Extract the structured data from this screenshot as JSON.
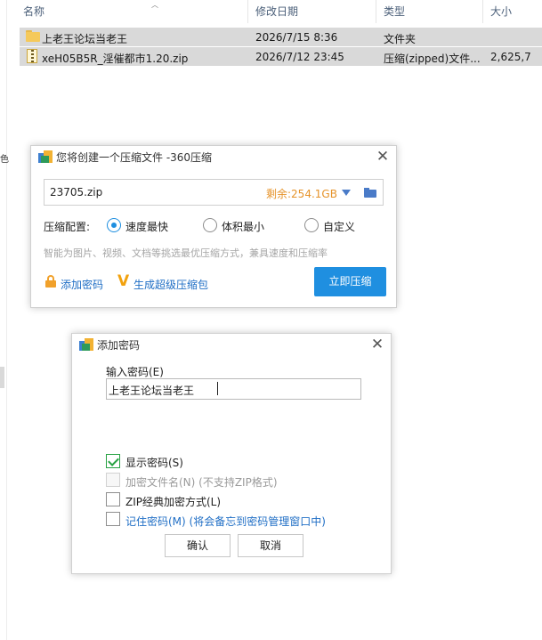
{
  "explorer": {
    "columns": {
      "name": "名称",
      "modified": "修改日期",
      "type": "类型",
      "size": "大小"
    },
    "files": [
      {
        "icon": "folder-icon",
        "name": "上老王论坛当老王",
        "modified": "2026/7/15 8:36",
        "type": "文件夹",
        "size": ""
      },
      {
        "icon": "zip-file-icon",
        "name": "xeH05B5R_淫催都市1.20.zip",
        "modified": "2026/7/12 23:45",
        "type": "压缩(zipped)文件...",
        "size": "2,625,7"
      }
    ],
    "left_glyph": "色"
  },
  "compress_dialog": {
    "title": "您将创建一个压缩文件 -360压缩",
    "archive_name": "23705.zip",
    "free_space": "剩余:254.1GB",
    "config_label": "压缩配置:",
    "options": [
      "速度最快",
      "体积最小",
      "自定义"
    ],
    "selected_option": "速度最快",
    "hint": "智能为图片、视频、文档等挑选最优压缩方式，兼具速度和压缩率",
    "add_password": "添加密码",
    "super_compress": "生成超级压缩包",
    "compress_now": "立即压缩"
  },
  "password_dialog": {
    "title": "添加密码",
    "input_label": "输入密码(E)",
    "password_value": "上老王论坛当老王",
    "show_password": "显示密码(S)",
    "show_password_checked": true,
    "encrypt_filenames": "加密文件名(N) (不支持ZIP格式)",
    "encrypt_filenames_disabled": true,
    "zip_classic": "ZIP经典加密方式(L)",
    "remember_password": "记住密码(M) (将会备忘到密码管理窗口中)",
    "ok": "确认",
    "cancel": "取消"
  },
  "colors": {
    "accent": "#1f8fe0",
    "free_space": "#e6932a",
    "link": "#1f6ec5",
    "check": "#27a243"
  }
}
